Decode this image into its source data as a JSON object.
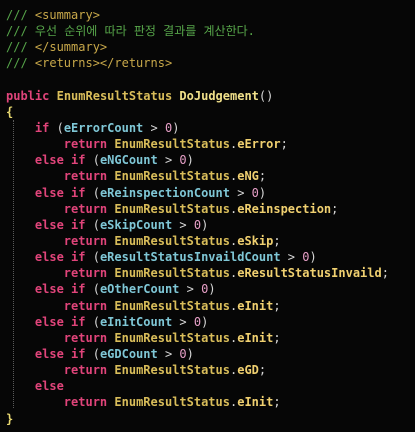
{
  "comment": {
    "prefix": "/// ",
    "summary_open": "<summary>",
    "summary_text": "우선 순위에 따라 판정 결과를 계산한다.",
    "summary_close": "</summary>",
    "returns": "<returns></returns>"
  },
  "signature": {
    "modifier": "public",
    "return_type": "EnumResultStatus",
    "name": "DoJudgement",
    "params": "()"
  },
  "braces": {
    "open": "{",
    "close": "}"
  },
  "keywords": {
    "if": "if",
    "else_if": "else if",
    "else": "else",
    "return": "return"
  },
  "enum_class": "EnumResultStatus",
  "branches": [
    {
      "kw": "if",
      "var": "eErrorCount",
      "cmp": " > ",
      "num": "0",
      "result": "eError"
    },
    {
      "kw": "else if",
      "var": "eNGCount",
      "cmp": " > ",
      "num": "0",
      "result": "eNG"
    },
    {
      "kw": "else if",
      "var": "eReinspectionCount",
      "cmp": " > ",
      "num": "0",
      "result": "eReinspection"
    },
    {
      "kw": "else if",
      "var": "eSkipCount",
      "cmp": " > ",
      "num": "0",
      "result": "eSkip"
    },
    {
      "kw": "else if",
      "var": "eResultStatusInvaildCount",
      "cmp": " > ",
      "num": "0",
      "result": "eResultStatusInvaild"
    },
    {
      "kw": "else if",
      "var": "eOtherCount",
      "cmp": " > ",
      "num": "0",
      "result": "eInit"
    },
    {
      "kw": "else if",
      "var": "eInitCount",
      "cmp": " > ",
      "num": "0",
      "result": "eInit"
    },
    {
      "kw": "else if",
      "var": "eGDCount",
      "cmp": " > ",
      "num": "0",
      "result": "eGD"
    }
  ],
  "else_result": "eInit",
  "colors": {
    "background": "#060606",
    "comment": "#57a64a",
    "keyword": "#e0447a",
    "type": "#d9bd5a",
    "identifier": "#7fc7d6",
    "number": "#e8a0c8"
  }
}
